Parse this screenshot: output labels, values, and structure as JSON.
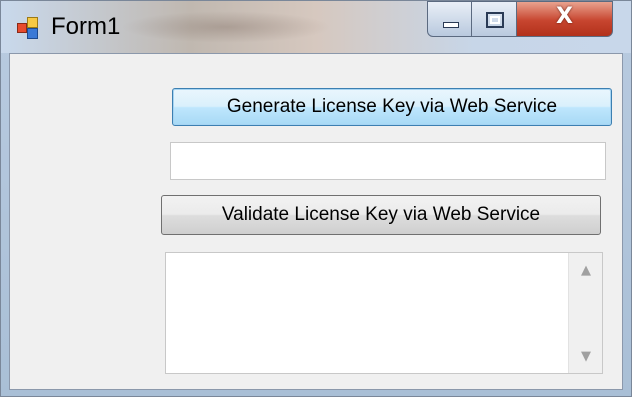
{
  "window": {
    "title": "Form1",
    "close_glyph": "X",
    "icons": {
      "app": "winforms-app-icon",
      "minimize": "minimize-icon",
      "maximize": "maximize-icon",
      "close": "close-icon"
    }
  },
  "form": {
    "generate_button_label": "Generate License Key via Web Service",
    "license_key_value": "",
    "validate_button_label": "Validate License Key via Web Service",
    "result_text": "",
    "scroll_up_glyph": "▲",
    "scroll_down_glyph": "▼"
  }
}
